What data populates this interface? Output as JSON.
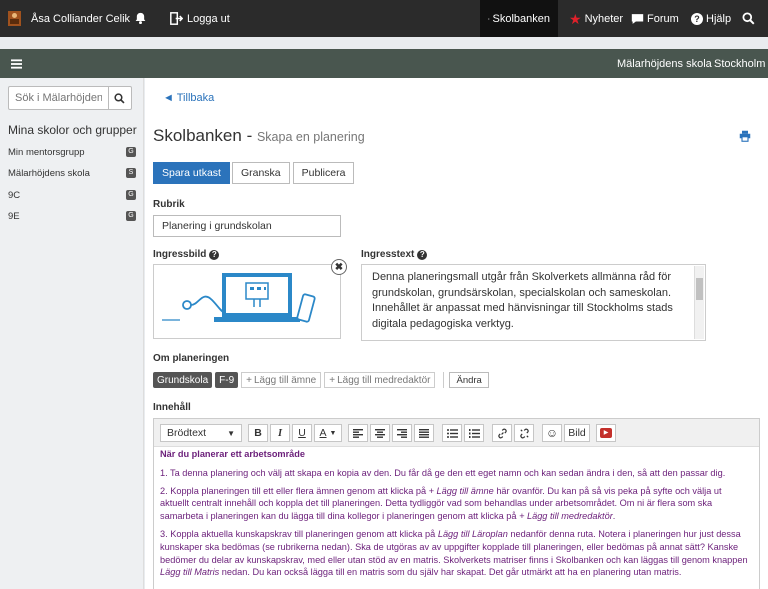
{
  "topbar": {
    "user_name": "Åsa Colliander Celik",
    "logout_label": "Logga ut",
    "nav": {
      "skolbanken": "Skolbanken",
      "nyheter": "Nyheter",
      "forum": "Forum",
      "hjalp": "Hjälp"
    }
  },
  "subbar": {
    "school": "Mälarhöjdens skola",
    "city": "Stockholm"
  },
  "sidebar": {
    "search_placeholder": "Sök i Mälarhöjdens",
    "title": "Mina skolor och grupper",
    "items": [
      {
        "label": "Min mentorsgrupp",
        "badge": "G"
      },
      {
        "label": "Mälarhöjdens skola",
        "badge": "S"
      },
      {
        "label": "9C",
        "badge": "G"
      },
      {
        "label": "9E",
        "badge": "G"
      }
    ]
  },
  "main": {
    "back": "◄ Tillbaka",
    "title": "Skolbanken",
    "title_sep": " - ",
    "subtitle": "Skapa en planering",
    "buttons": {
      "save_draft": "Spara utkast",
      "review": "Granska",
      "publish": "Publicera"
    },
    "rubrik_label": "Rubrik",
    "rubrik_value": "Planering i grundskolan",
    "ingressbild_label": "Ingressbild",
    "ingresstext_label": "Ingresstext",
    "ingresstext_value": "Denna planeringsmall utgår från Skolverkets allmänna råd för grundskolan, grundsärskolan, specialskolan och sameskolan. Innehållet är anpassat med hänvisningar till Stockholms stads digitala pedagogiska verktyg.",
    "om_label": "Om planeringen",
    "tags": [
      "Grundskola",
      "F-9"
    ],
    "add_subject": "Lägg till ämne",
    "add_coeditor": "Lägg till medredaktör",
    "andra": "Ändra",
    "innehall_label": "Innehåll"
  },
  "editor": {
    "format_select": "Brödtext",
    "image_label": "Bild",
    "heading": "När du planerar ett arbetsområde",
    "p1": "1. Ta denna planering och välj att skapa en kopia av den. Du får då ge den ett eget namn och kan sedan ändra i den, så att den passar dig.",
    "p2_a": "2. Koppla planeringen till ett eller flera ämnen genom att klicka på ",
    "p2_em1": "+ Lägg till ämne",
    "p2_b": " här ovanför. Du kan på så vis peka på syfte och välja ut aktuellt centralt innehåll och koppla det till planeringen. Detta tydliggör vad som behandlas under arbetsområdet. Om ni är flera som ska samarbeta i planeringen kan du lägga till dina kollegor i planeringen genom att klicka på ",
    "p2_em2": "+ Lägg till medredaktör",
    "p2_c": ".",
    "p3_a": "3. Koppla aktuella kunskapskrav till planeringen genom att klicka på ",
    "p3_em1": "Lägg till Läroplan",
    "p3_b": " nedanför denna ruta. Notera i planeringen hur just dessa kunskaper ska bedömas (se rubrikerna nedan). Ska de utgöras av av uppgifter kopplade till planeringen, eller bedömas på annat sätt? Kanske bedömer du delar av kunskapskrav, med eller utan stöd av en matris. Skolverkets matriser finns i Skolbanken och kan läggas till genom knappen ",
    "p3_em2": "Lägg till Matris",
    "p3_c": " nedan. Du kan också lägga till en matris som du själv har skapat. Det går utmärkt att ha en planering utan matris."
  },
  "colors": {
    "topbar": "#2b2b2b",
    "subbar": "#49564f",
    "primary": "#2b73bb",
    "content_text": "#6b1f7a",
    "nyheter_star": "#e0202a"
  },
  "icons": [
    "bell-icon",
    "logout-icon",
    "database-icon",
    "star-icon",
    "chat-icon",
    "help-icon",
    "search-icon",
    "menu-icon",
    "print-icon",
    "info-icon",
    "close-icon"
  ]
}
